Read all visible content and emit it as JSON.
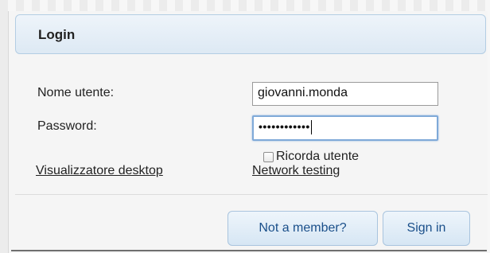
{
  "panel": {
    "title": "Login"
  },
  "form": {
    "username_label": "Nome utente:",
    "username_value": "giovanni.monda",
    "password_label": "Password:",
    "password_masked": "••••••••••••",
    "remember_label": "Ricorda utente",
    "remember_checked": false
  },
  "links": {
    "desktop_viewer": "Visualizzatore desktop",
    "network_testing": "Network testing"
  },
  "buttons": {
    "not_member": "Not a member?",
    "sign_in": "Sign in"
  },
  "colors": {
    "header_border": "#b3cde3",
    "button_text": "#1a4f8a",
    "focus_ring": "#7fa9d8"
  }
}
